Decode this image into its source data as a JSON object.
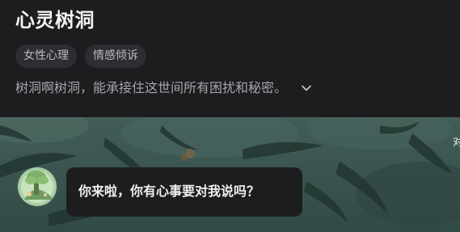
{
  "header": {
    "title": "心灵树洞",
    "tags": [
      "女性心理",
      "情感倾诉"
    ],
    "description": "树洞啊树洞，能承接住这世间所有困扰和秘密。",
    "expand_icon": "chevron-down-icon"
  },
  "chat": {
    "edge_text": "对",
    "messages": [
      {
        "sender_avatar": "avatar",
        "text": "你来啦，你有心事要对我说吗？"
      }
    ]
  },
  "colors": {
    "header_bg": "#1c1d1f",
    "tag_bg": "#2c2e32",
    "chat_bg": "#3b5651",
    "bubble_bg": "#1c1d1f"
  }
}
